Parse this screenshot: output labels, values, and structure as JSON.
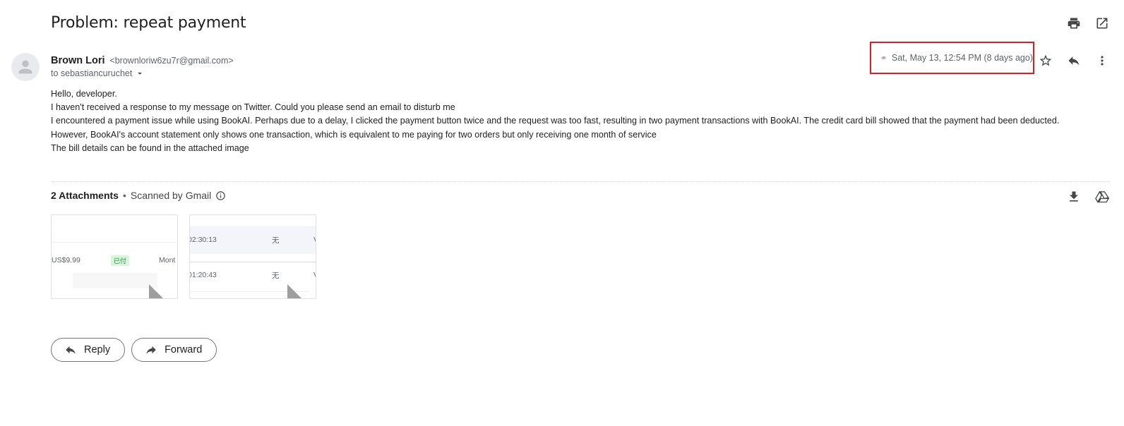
{
  "email": {
    "subject": "Problem: repeat payment",
    "sender_name": "Brown Lori",
    "sender_email": "<brownloriw6zu7r@gmail.com>",
    "to_line": "to sebastiancuruchet",
    "date": "Sat, May 13, 12:54 PM (8 days ago)",
    "body_lines": [
      "Hello, developer.",
      "I haven't received a response to my message on Twitter. Could you please send an email to disturb me",
      "I encountered a payment issue while using BookAI. Perhaps due to a delay, I clicked the payment button twice and the request was too fast, resulting in two payment transactions with BookAI. The credit card bill showed that the payment had been deducted.",
      "However, BookAI's account statement only shows one transaction, which is equivalent to me paying for two orders but only receiving one month of service",
      "The bill details can be found in the attached image"
    ]
  },
  "attachments": {
    "count_label": "2 Attachments",
    "separator": "•",
    "scanned_label": "Scanned by Gmail",
    "thumb1": {
      "amount": "US$9.99",
      "status": "已付",
      "plan": "Mont"
    },
    "thumb2": {
      "time1": "02:30:13",
      "val1": "无",
      "time2": "01:20:43",
      "val2": "无",
      "trail": "V"
    }
  },
  "buttons": {
    "reply": "Reply",
    "forward": "Forward"
  },
  "icons": {
    "print": "print-icon",
    "open_new": "open-in-new-icon",
    "attachment": "paperclip-icon",
    "star": "star-icon",
    "reply": "reply-icon",
    "more": "more-vert-icon",
    "download": "download-icon",
    "drive": "add-to-drive-icon",
    "info": "info-icon",
    "avatar": "person-icon"
  },
  "colors": {
    "highlight_border": "#e01b24"
  }
}
